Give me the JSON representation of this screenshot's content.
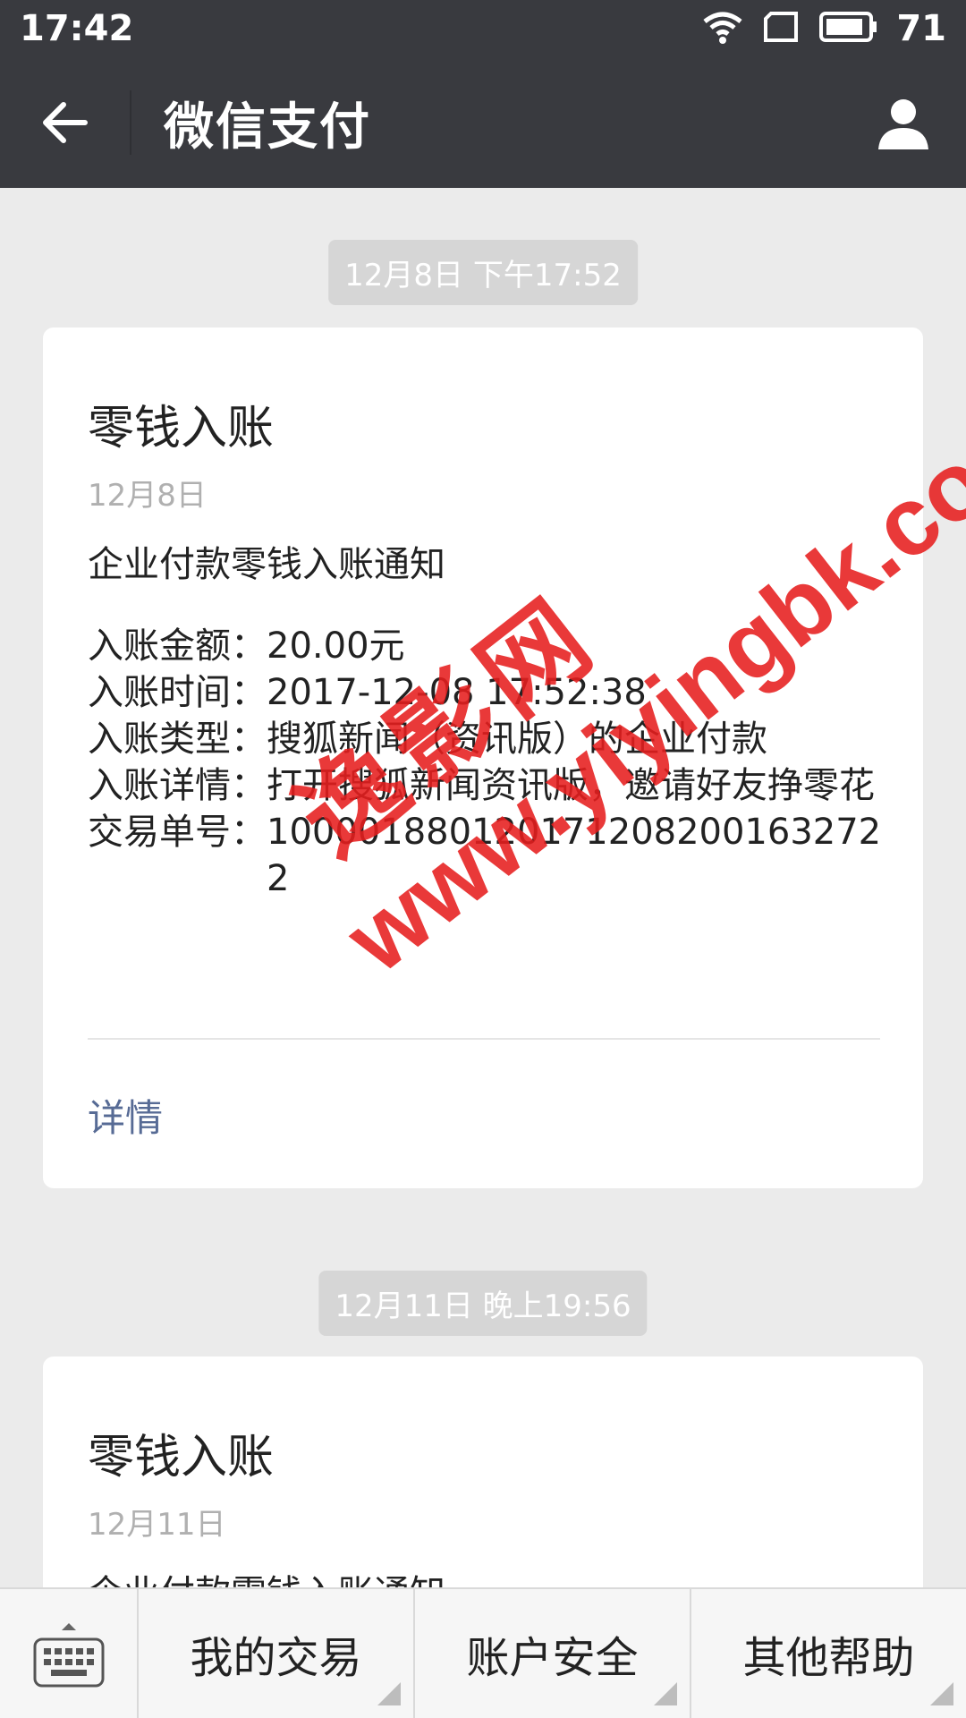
{
  "status_bar": {
    "time": "17:42",
    "battery": "71"
  },
  "header": {
    "title": "微信支付"
  },
  "messages": [
    {
      "timestamp": "12月8日 下午17:52",
      "title": "零钱入账",
      "date": "12月8日",
      "subtitle": "企业付款零钱入账通知",
      "lines": [
        {
          "label": "入账金额：",
          "value": "20.00元"
        },
        {
          "label": "入账时间：",
          "value": "2017-12-08 17:52:38"
        },
        {
          "label": "入账类型：",
          "value": "搜狐新闻（资讯版）的企业付款"
        },
        {
          "label": "入账详情：",
          "value": "打开搜狐新闻资讯版，邀请好友挣零花"
        },
        {
          "label": "交易单号：",
          "value": "1000018801201712082001632722"
        }
      ],
      "detail_link": "详情"
    },
    {
      "timestamp": "12月11日 晚上19:56",
      "title": "零钱入账",
      "date": "12月11日",
      "subtitle": "企业付款零钱入账通知"
    }
  ],
  "watermark": {
    "cn": "逸影网",
    "url": "www.yiyingbk.com"
  },
  "bottom_menu": [
    "我的交易",
    "账户安全",
    "其他帮助"
  ],
  "colors": {
    "header_bg": "#393a3f",
    "page_bg": "#ebebeb",
    "link": "#576b95",
    "watermark": "#e61e1e"
  }
}
